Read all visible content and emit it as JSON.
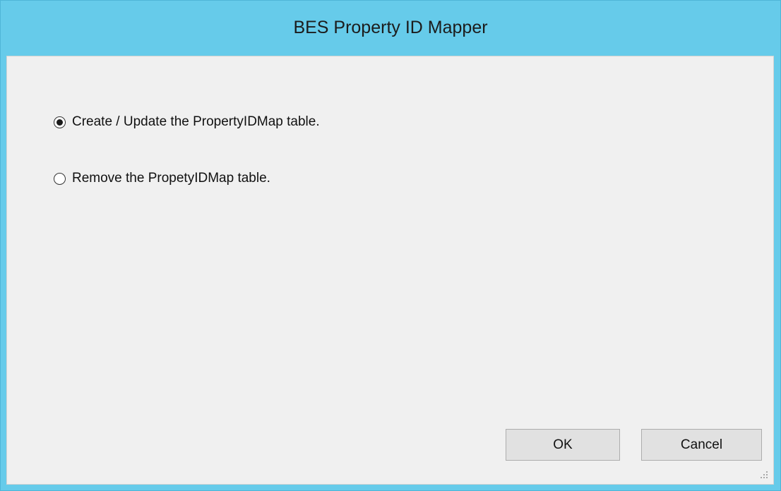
{
  "window": {
    "title": "BES Property ID Mapper"
  },
  "options": [
    {
      "label": "Create / Update the PropertyIDMap table.",
      "selected": true
    },
    {
      "label": "Remove the PropetyIDMap table.",
      "selected": false
    }
  ],
  "buttons": {
    "ok_label": "OK",
    "cancel_label": "Cancel"
  },
  "colors": {
    "titlebar": "#66cbea",
    "client_background": "#f0f0f0",
    "button_background": "#e1e1e1"
  },
  "icons": {
    "resize_grip": "resize-grip-icon"
  }
}
